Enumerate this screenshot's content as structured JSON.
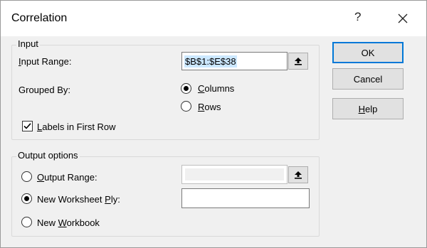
{
  "window": {
    "title": "Correlation",
    "help_glyph": "?",
    "close_icon": "close-icon"
  },
  "input_group": {
    "legend": "Input",
    "input_range_label_pre": "",
    "input_range_label_u": "I",
    "input_range_label_post": "nput Range:",
    "input_range_value": "$B$1:$E$38",
    "grouped_by_label": "Grouped By:",
    "columns_label_u": "C",
    "columns_label_post": "olumns",
    "rows_label_u": "R",
    "rows_label_post": "ows",
    "grouped_by_selected": "Columns",
    "labels_first_row_u": "L",
    "labels_first_row_post": "abels in First Row",
    "labels_first_row_checked": true
  },
  "output_group": {
    "legend": "Output options",
    "output_range_u": "O",
    "output_range_post": "utput Range:",
    "output_range_value": "",
    "new_ws_pre": "New Worksheet ",
    "new_ws_u": "P",
    "new_ws_post": "ly:",
    "new_ws_value": "",
    "new_wb_pre": "New ",
    "new_wb_u": "W",
    "new_wb_post": "orkbook",
    "selected": "New Worksheet Ply"
  },
  "buttons": {
    "ok": "OK",
    "cancel": "Cancel",
    "help_u": "H",
    "help_post": "elp"
  }
}
